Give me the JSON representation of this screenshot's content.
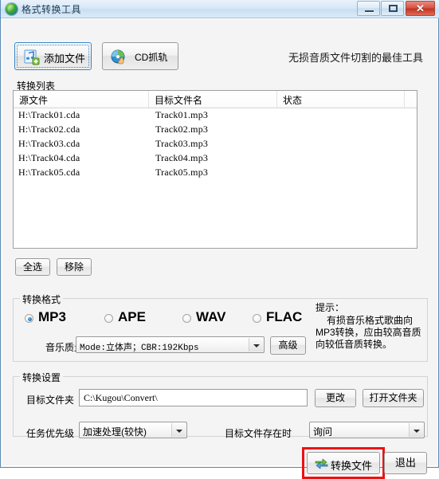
{
  "window": {
    "title": "格式转换工具",
    "app_icon": "globe-icon",
    "controls": {
      "minimize": "minimize-icon",
      "maximize": "maximize-icon",
      "close": "✕"
    }
  },
  "toolbar": {
    "add_file_label": "添加文件",
    "add_file_icon": "music-note-plus-icon",
    "cd_rip_label": "CD抓轨",
    "cd_rip_icon": "cd-hand-icon",
    "tagline": "无损音质文件切割的最佳工具"
  },
  "list_section": {
    "group_label": "转换列表",
    "columns": [
      "源文件",
      "目标文件名",
      "状态"
    ],
    "rows": [
      {
        "source": "H:\\Track01.cda",
        "target": "Track01.mp3",
        "status": ""
      },
      {
        "source": "H:\\Track02.cda",
        "target": "Track02.mp3",
        "status": ""
      },
      {
        "source": "H:\\Track03.cda",
        "target": "Track03.mp3",
        "status": ""
      },
      {
        "source": "H:\\Track04.cda",
        "target": "Track04.mp3",
        "status": ""
      },
      {
        "source": "H:\\Track05.cda",
        "target": "Track05.mp3",
        "status": ""
      }
    ],
    "select_all_label": "全选",
    "remove_label": "移除"
  },
  "format_section": {
    "group_label": "转换格式",
    "options": [
      {
        "label": "MP3",
        "checked": true
      },
      {
        "label": "APE",
        "checked": false
      },
      {
        "label": "WAV",
        "checked": false
      },
      {
        "label": "FLAC",
        "checked": false
      }
    ],
    "selected": "MP3",
    "quality_label": "音乐质量",
    "quality_value": "Mode:立体声；CBR:192Kbps",
    "advanced_label": "高级",
    "tip_title": "提示：",
    "tip_body": "有损音乐格式歌曲向MP3转换，应由较高音质向较低音质转换。"
  },
  "settings_section": {
    "group_label": "转换设置",
    "dest_folder_label": "目标文件夹",
    "dest_folder_value": "C:\\Kugou\\Convert\\",
    "change_label": "更改",
    "open_folder_label": "打开文件夹",
    "priority_label": "任务优先级",
    "priority_value": "加速处理(较快)",
    "exists_label": "目标文件存在时",
    "exists_value": "询问"
  },
  "actions": {
    "convert_label": "转换文件",
    "convert_icon": "convert-arrows-icon",
    "exit_label": "退出",
    "highlight_color": "#ee1111"
  }
}
